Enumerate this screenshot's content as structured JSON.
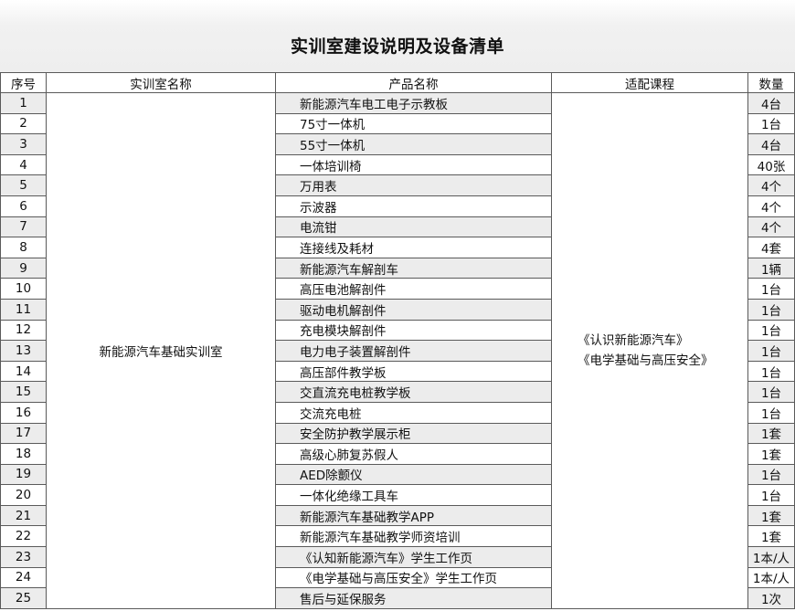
{
  "title": "实训室建设说明及设备清单",
  "headers": [
    "序号",
    "实训室名称",
    "产品名称",
    "适配课程",
    "数量"
  ],
  "lab_name": "新能源汽车基础实训室",
  "courses": [
    "《认识新能源汽车》",
    "《电学基础与高压安全》"
  ],
  "rows": [
    {
      "no": "1",
      "product": "新能源汽车电工电子示教板",
      "qty": "4台"
    },
    {
      "no": "2",
      "product": "75寸一体机",
      "qty": "1台"
    },
    {
      "no": "3",
      "product": "55寸一体机",
      "qty": "4台"
    },
    {
      "no": "4",
      "product": "一体培训椅",
      "qty": "40张"
    },
    {
      "no": "5",
      "product": "万用表",
      "qty": "4个"
    },
    {
      "no": "6",
      "product": "示波器",
      "qty": "4个"
    },
    {
      "no": "7",
      "product": "电流钳",
      "qty": "4个"
    },
    {
      "no": "8",
      "product": "连接线及耗材",
      "qty": "4套"
    },
    {
      "no": "9",
      "product": "新能源汽车解剖车",
      "qty": "1辆"
    },
    {
      "no": "10",
      "product": "高压电池解剖件",
      "qty": "1台"
    },
    {
      "no": "11",
      "product": "驱动电机解剖件",
      "qty": "1台"
    },
    {
      "no": "12",
      "product": "充电模块解剖件",
      "qty": "1台"
    },
    {
      "no": "13",
      "product": "电力电子装置解剖件",
      "qty": "1台"
    },
    {
      "no": "14",
      "product": "高压部件教学板",
      "qty": "1台"
    },
    {
      "no": "15",
      "product": "交直流充电桩教学板",
      "qty": "1台"
    },
    {
      "no": "16",
      "product": "交流充电桩",
      "qty": "1台"
    },
    {
      "no": "17",
      "product": "安全防护教学展示柜",
      "qty": "1套"
    },
    {
      "no": "18",
      "product": "高级心肺复苏假人",
      "qty": "1套"
    },
    {
      "no": "19",
      "product": "AED除颤仪",
      "qty": "1台"
    },
    {
      "no": "20",
      "product": "一体化绝缘工具车",
      "qty": "1台"
    },
    {
      "no": "21",
      "product": "新能源汽车基础教学APP",
      "qty": "1套"
    },
    {
      "no": "22",
      "product": "新能源汽车基础教学师资培训",
      "qty": "1套"
    },
    {
      "no": "23",
      "product": "《认知新能源汽车》学生工作页",
      "qty": "1本/人"
    },
    {
      "no": "24",
      "product": "《电学基础与高压安全》学生工作页",
      "qty": "1本/人"
    },
    {
      "no": "25",
      "product": "售后与延保服务",
      "qty": "1次"
    }
  ]
}
